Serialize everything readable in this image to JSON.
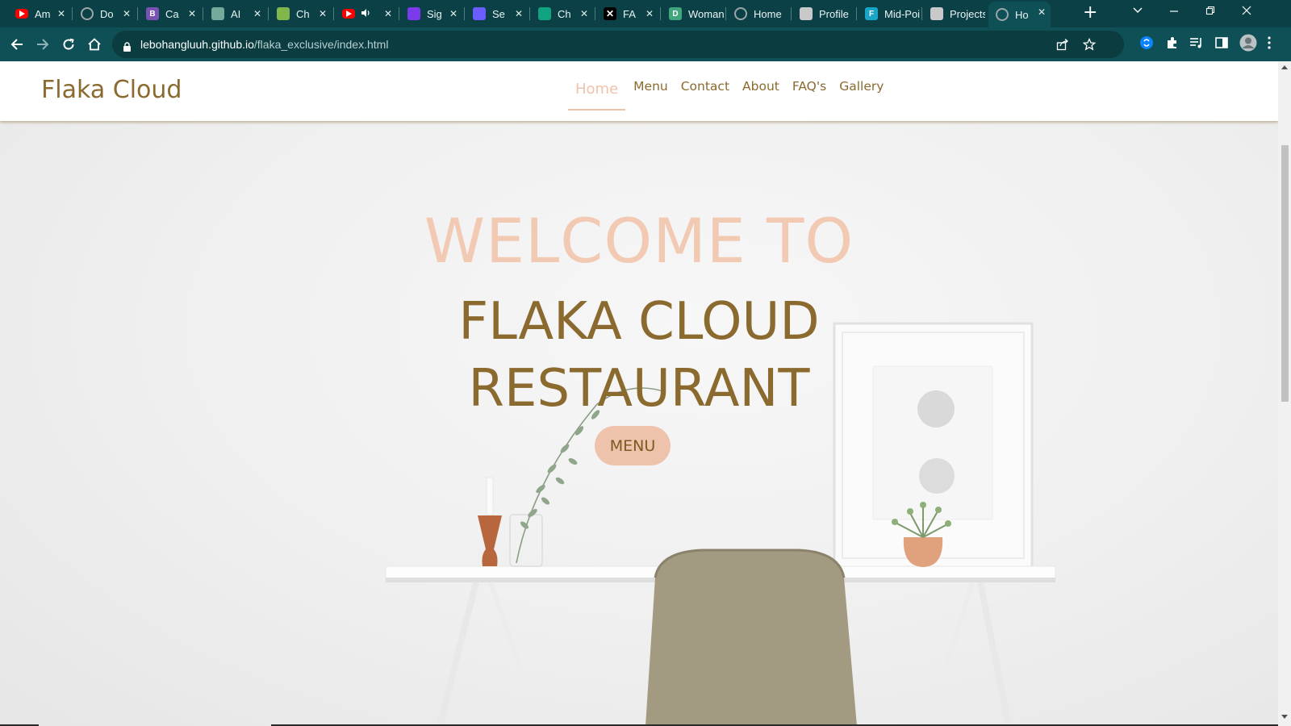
{
  "browser": {
    "tabs": [
      {
        "title": "Am",
        "favicon": "youtube-icon",
        "color": "#ff0000"
      },
      {
        "title": "Do",
        "favicon": "globe-icon",
        "color": "#9aa6a8"
      },
      {
        "title": "Ca",
        "favicon": "bootstrap-icon",
        "color": "#7952b3"
      },
      {
        "title": "AI",
        "favicon": "openai-icon",
        "color": "#74aa9c"
      },
      {
        "title": "Ch",
        "favicon": "chess-icon",
        "color": "#81b64c"
      },
      {
        "title": "",
        "favicon": "youtube-icon",
        "color": "#ff0000",
        "audio": "speaker-icon"
      },
      {
        "title": "Sig",
        "favicon": "om-icon",
        "color": "#7c3aed"
      },
      {
        "title": "Se",
        "favicon": "search-engine-icon",
        "color": "#6b5cff"
      },
      {
        "title": "Ch",
        "favicon": "chatgpt-icon",
        "color": "#10a37f"
      },
      {
        "title": "FA",
        "favicon": "x-logo-icon",
        "color": "#000000"
      },
      {
        "title": "Woman",
        "favicon": "d-icon",
        "color": "#3fa77b"
      },
      {
        "title": "Home",
        "favicon": "globe-icon",
        "color": "#9aa6a8"
      },
      {
        "title": "Profile",
        "favicon": "profile-page-icon",
        "color": "#c9c9c9"
      },
      {
        "title": "Mid-Poi",
        "favicon": "figma-icon",
        "color": "#1aa4c8"
      },
      {
        "title": "Projects",
        "favicon": "profile-page-icon",
        "color": "#c9c9c9"
      },
      {
        "title": "Ho",
        "favicon": "globe-icon",
        "color": "#9aa6a8",
        "active": true
      }
    ],
    "new_tab": "+",
    "url": {
      "host": "lebohangluuh.github.io",
      "path": "/flaka_exclusive/index.html"
    }
  },
  "site": {
    "brand": "Flaka Cloud",
    "nav": [
      {
        "label": "Home",
        "active": true
      },
      {
        "label": "Menu"
      },
      {
        "label": "Contact"
      },
      {
        "label": "About"
      },
      {
        "label": "FAQ's"
      },
      {
        "label": "Gallery"
      }
    ],
    "hero": {
      "welcome": "WELCOME TO",
      "title_line1": "FLAKA CLOUD",
      "title_line2": "RESTAURANT",
      "button": "MENU"
    }
  },
  "colors": {
    "tabstrip": "#0b4146",
    "toolbar": "#0f5056",
    "brand": "#8b6a2f",
    "accent": "#efc2ab"
  }
}
